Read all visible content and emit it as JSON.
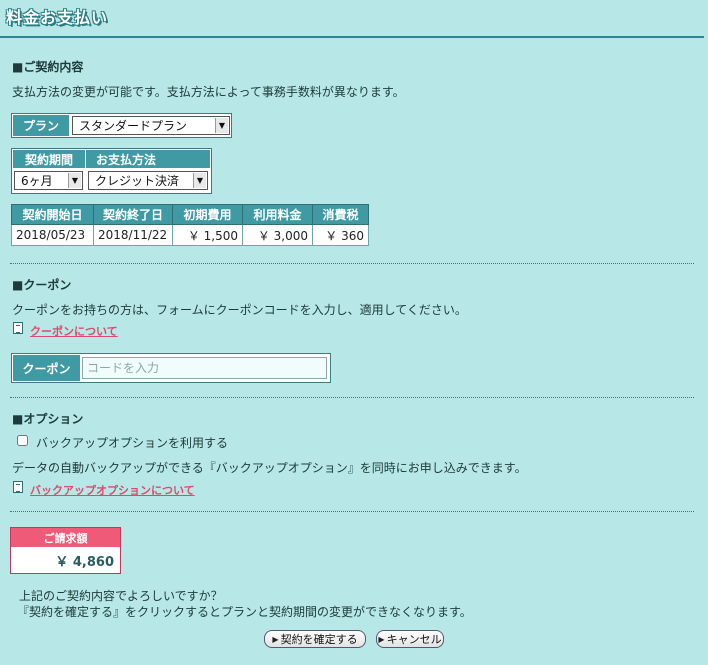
{
  "page": {
    "title": "料金お支払い"
  },
  "contract": {
    "heading": "■ご契約内容",
    "description": "支払方法の変更が可能です。支払方法によって事務手数料が異なります。",
    "plan_label": "プラン",
    "plan_value": "スタンダードプラン",
    "period_label": "契約期間",
    "period_value": "6ヶ月",
    "payment_label": "お支払方法",
    "payment_value": "クレジット決済",
    "table": {
      "headers": [
        "契約開始日",
        "契約終了日",
        "初期費用",
        "利用料金",
        "消費税"
      ],
      "row": [
        "2018/05/23",
        "2018/11/22",
        "￥ 1,500",
        "￥ 3,000",
        "￥ 360"
      ]
    }
  },
  "coupon": {
    "heading": "■クーポン",
    "description": "クーポンをお持ちの方は、フォームにクーポンコードを入力し、適用してください。",
    "link": "クーポンについて",
    "label": "クーポン",
    "placeholder": "コードを入力"
  },
  "option": {
    "heading": "■オプション",
    "checkbox_label": "バックアップオプションを利用する",
    "description": "データの自動バックアップができる『バックアップオプション』を同時にお申し込みできます。",
    "link": "バックアップオプションについて"
  },
  "billing": {
    "label": "ご請求額",
    "amount": "￥ 4,860"
  },
  "confirm": {
    "line1": "上記のご契約内容でよろしいですか？",
    "line2": "『契約を確定する』をクリックするとプランと契約期間の変更ができなくなります。",
    "confirm_button": "契約を確定する",
    "cancel_button": "キャンセル"
  },
  "icons": {
    "select_arrow": "dropdown-arrow-icon",
    "doc": "document-icon",
    "button_arrow": "triangle-right-icon"
  },
  "colors": {
    "background": "#b7e7e6",
    "header_cell": "#3f9aa3",
    "link": "#e0496a",
    "billing_head": "#ee5a78"
  }
}
